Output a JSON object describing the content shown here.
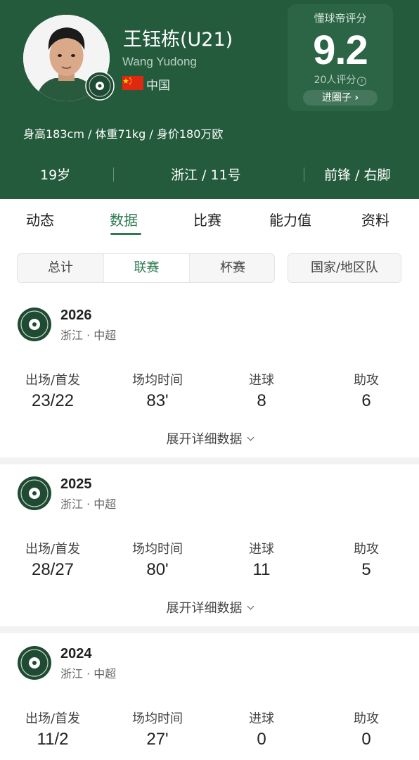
{
  "player": {
    "name": "王钰栋(U21)",
    "name_en": "Wang Yudong",
    "country": "中国",
    "body_info": "身高183cm / 体重71kg / 身价180万欧",
    "age": "19岁",
    "team_number": "浙江 / 11号",
    "position_foot": "前锋 / 右脚"
  },
  "rating": {
    "title": "懂球帝评分",
    "value": "9.2",
    "count": "20人评分",
    "info_icon": "ⓘ",
    "button": "进圈子",
    "button_arrow": "›"
  },
  "tabs": [
    "动态",
    "数据",
    "比赛",
    "能力值",
    "资料"
  ],
  "active_tab": "数据",
  "filters": {
    "segments": [
      "总计",
      "联赛",
      "杯赛"
    ],
    "active": "联赛",
    "national": "国家/地区队"
  },
  "stat_labels": [
    "出场/首发",
    "场均时间",
    "进球",
    "助攻"
  ],
  "expand_label": "展开详细数据",
  "seasons": [
    {
      "year": "2026",
      "league": "浙江 · 中超",
      "appearances": "23/22",
      "avg_time": "83'",
      "goals": "8",
      "assists": "6"
    },
    {
      "year": "2025",
      "league": "浙江 · 中超",
      "appearances": "28/27",
      "avg_time": "80'",
      "goals": "11",
      "assists": "5"
    },
    {
      "year": "2024",
      "league": "浙江 · 中超",
      "appearances": "11/2",
      "avg_time": "27'",
      "goals": "0",
      "assists": "0"
    }
  ],
  "colors": {
    "header_bg": "#245b3d",
    "accent": "#2d7a52",
    "club_logo": "#1f4a33"
  },
  "icons": {
    "flag": "china-flag-icon",
    "club": "zhejiang-club-logo",
    "chevron": "chevron-down-icon"
  }
}
